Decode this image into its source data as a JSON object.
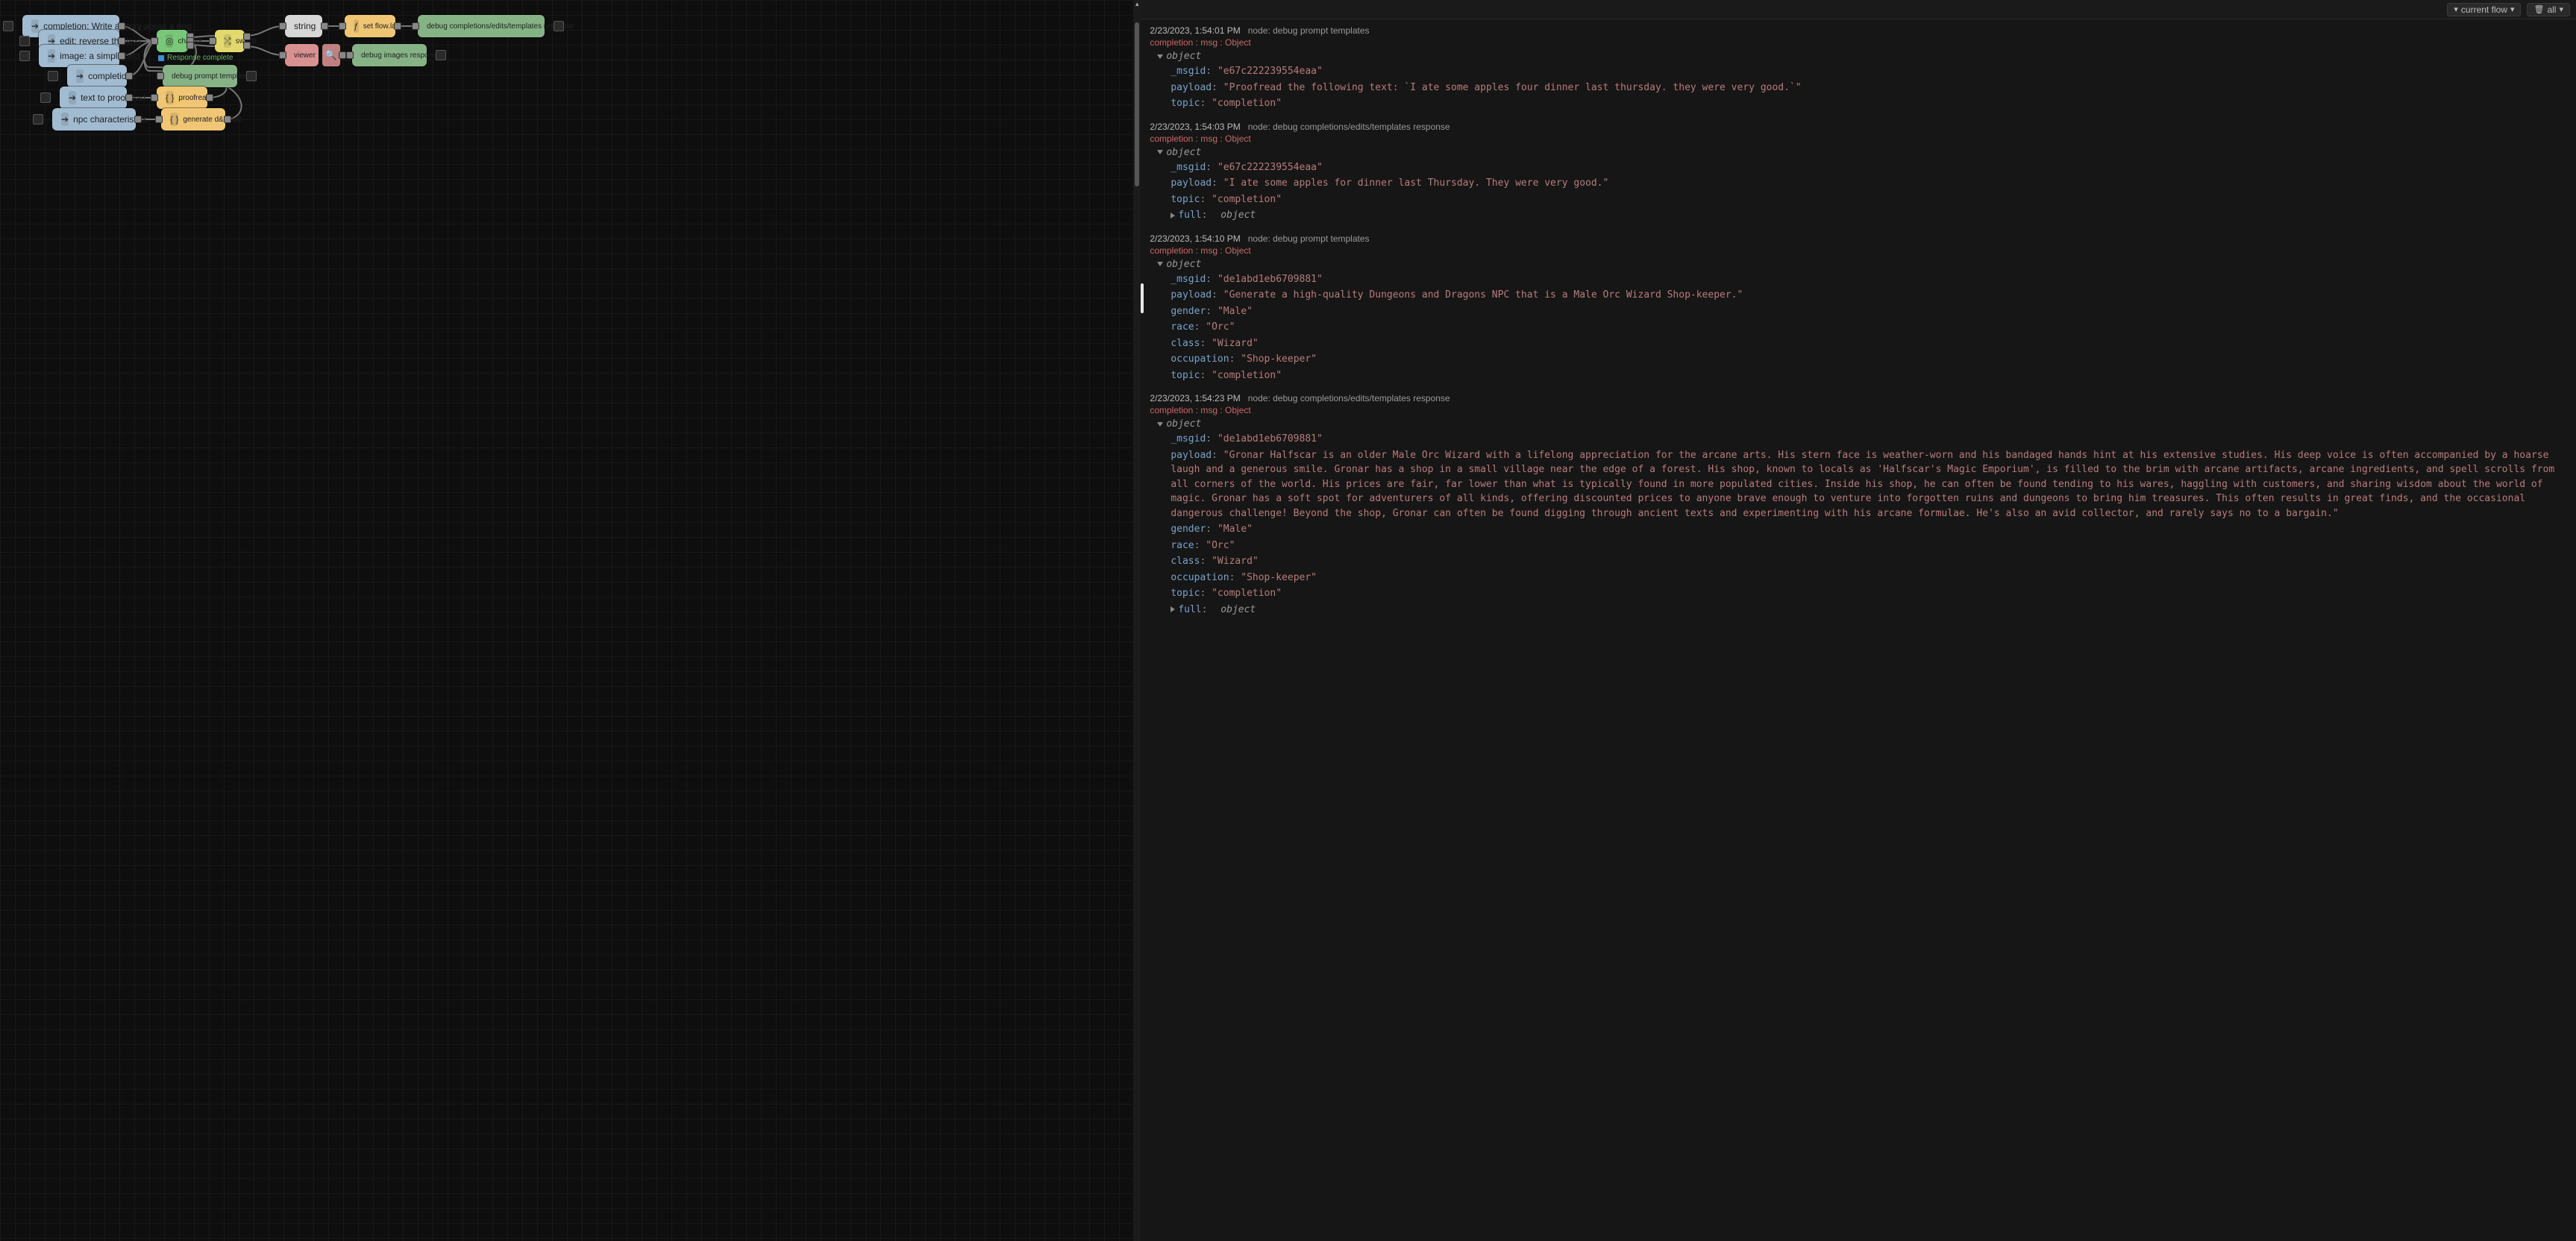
{
  "toolbar": {
    "filter_label": "current flow",
    "clear_label": "all"
  },
  "status": {
    "text": "Response complete"
  },
  "nodes": {
    "i1": "completion: Write a story about a dog",
    "i2": "edit: reverse the text",
    "i3": "image: a simple bird",
    "i4": "completion",
    "i5": "text to proofread",
    "i6": "npc characteristics",
    "chat": "chatgpt",
    "switch": "switch",
    "string": "string",
    "setflow": "set flow.last",
    "dbg1": "debug completions/edits/templates response",
    "viewer": "viewer",
    "dbgimg": "debug images response",
    "dbgpt": "debug prompt templates",
    "proofread": "proofread",
    "gennpc": "generate d&d npc"
  },
  "debug": [
    {
      "ts": "2/23/2023, 1:54:01 PM",
      "src": "node: debug prompt templates",
      "topicline": "completion : msg : Object",
      "open": true,
      "kv": [
        {
          "k": "_msgid",
          "t": "str",
          "v": "\"e67c222239554eaa\""
        },
        {
          "k": "payload",
          "t": "str",
          "v": "\"Proofread the following text: `I ate some apples four dinner last thursday. they were very good.`\""
        },
        {
          "k": "topic",
          "t": "str",
          "v": "\"completion\""
        }
      ]
    },
    {
      "ts": "2/23/2023, 1:54:03 PM",
      "src": "node: debug completions/edits/templates response",
      "topicline": "completion : msg : Object",
      "open": true,
      "kv": [
        {
          "k": "_msgid",
          "t": "str",
          "v": "\"e67c222239554eaa\""
        },
        {
          "k": "payload",
          "t": "str",
          "v": "\"I ate some apples for dinner last Thursday. They were very good.\""
        },
        {
          "k": "topic",
          "t": "str",
          "v": "\"completion\""
        },
        {
          "k": "full",
          "t": "obj",
          "v": "object",
          "collapsed": true
        }
      ]
    },
    {
      "ts": "2/23/2023, 1:54:10 PM",
      "src": "node: debug prompt templates",
      "topicline": "completion : msg : Object",
      "open": true,
      "kv": [
        {
          "k": "_msgid",
          "t": "str",
          "v": "\"de1abd1eb6709881\""
        },
        {
          "k": "payload",
          "t": "str",
          "v": "\"Generate a high-quality Dungeons and Dragons NPC that is a Male Orc Wizard Shop-keeper.\""
        },
        {
          "k": "gender",
          "t": "str",
          "v": "\"Male\""
        },
        {
          "k": "race",
          "t": "str",
          "v": "\"Orc\""
        },
        {
          "k": "class",
          "t": "str",
          "v": "\"Wizard\""
        },
        {
          "k": "occupation",
          "t": "str",
          "v": "\"Shop-keeper\""
        },
        {
          "k": "topic",
          "t": "str",
          "v": "\"completion\""
        }
      ]
    },
    {
      "ts": "2/23/2023, 1:54:23 PM",
      "src": "node: debug completions/edits/templates response",
      "topicline": "completion : msg : Object",
      "open": true,
      "kv": [
        {
          "k": "_msgid",
          "t": "str",
          "v": "\"de1abd1eb6709881\""
        },
        {
          "k": "payload",
          "t": "str",
          "v": "\"Gronar Halfscar is an older Male Orc Wizard with a lifelong appreciation for the arcane arts. His stern face is weather-worn and his bandaged hands hint at his extensive studies. His deep voice is often accompanied by a hoarse laugh and a generous smile. Gronar has a shop in a small village near the edge of a forest. His shop, known to locals as 'Halfscar's Magic Emporium', is filled to the brim with arcane artifacts, arcane ingredients, and spell scrolls from all corners of the world. His prices are fair, far lower than what is typically found in more populated cities. Inside his shop, he can often be found tending to his wares, haggling with customers, and sharing wisdom about the world of magic. Gronar has a soft spot for adventurers of all kinds, offering discounted prices to anyone brave enough to venture into forgotten ruins and dungeons to bring him treasures. This often results in great finds, and the occasional dangerous challenge! Beyond the shop, Gronar can often be found digging through ancient texts and experimenting with his arcane formulae. He's also an avid collector, and rarely says no to a bargain.\""
        },
        {
          "k": "gender",
          "t": "str",
          "v": "\"Male\""
        },
        {
          "k": "race",
          "t": "str",
          "v": "\"Orc\""
        },
        {
          "k": "class",
          "t": "str",
          "v": "\"Wizard\""
        },
        {
          "k": "occupation",
          "t": "str",
          "v": "\"Shop-keeper\""
        },
        {
          "k": "topic",
          "t": "str",
          "v": "\"completion\""
        },
        {
          "k": "full",
          "t": "obj",
          "v": "object",
          "collapsed": true
        }
      ]
    }
  ]
}
